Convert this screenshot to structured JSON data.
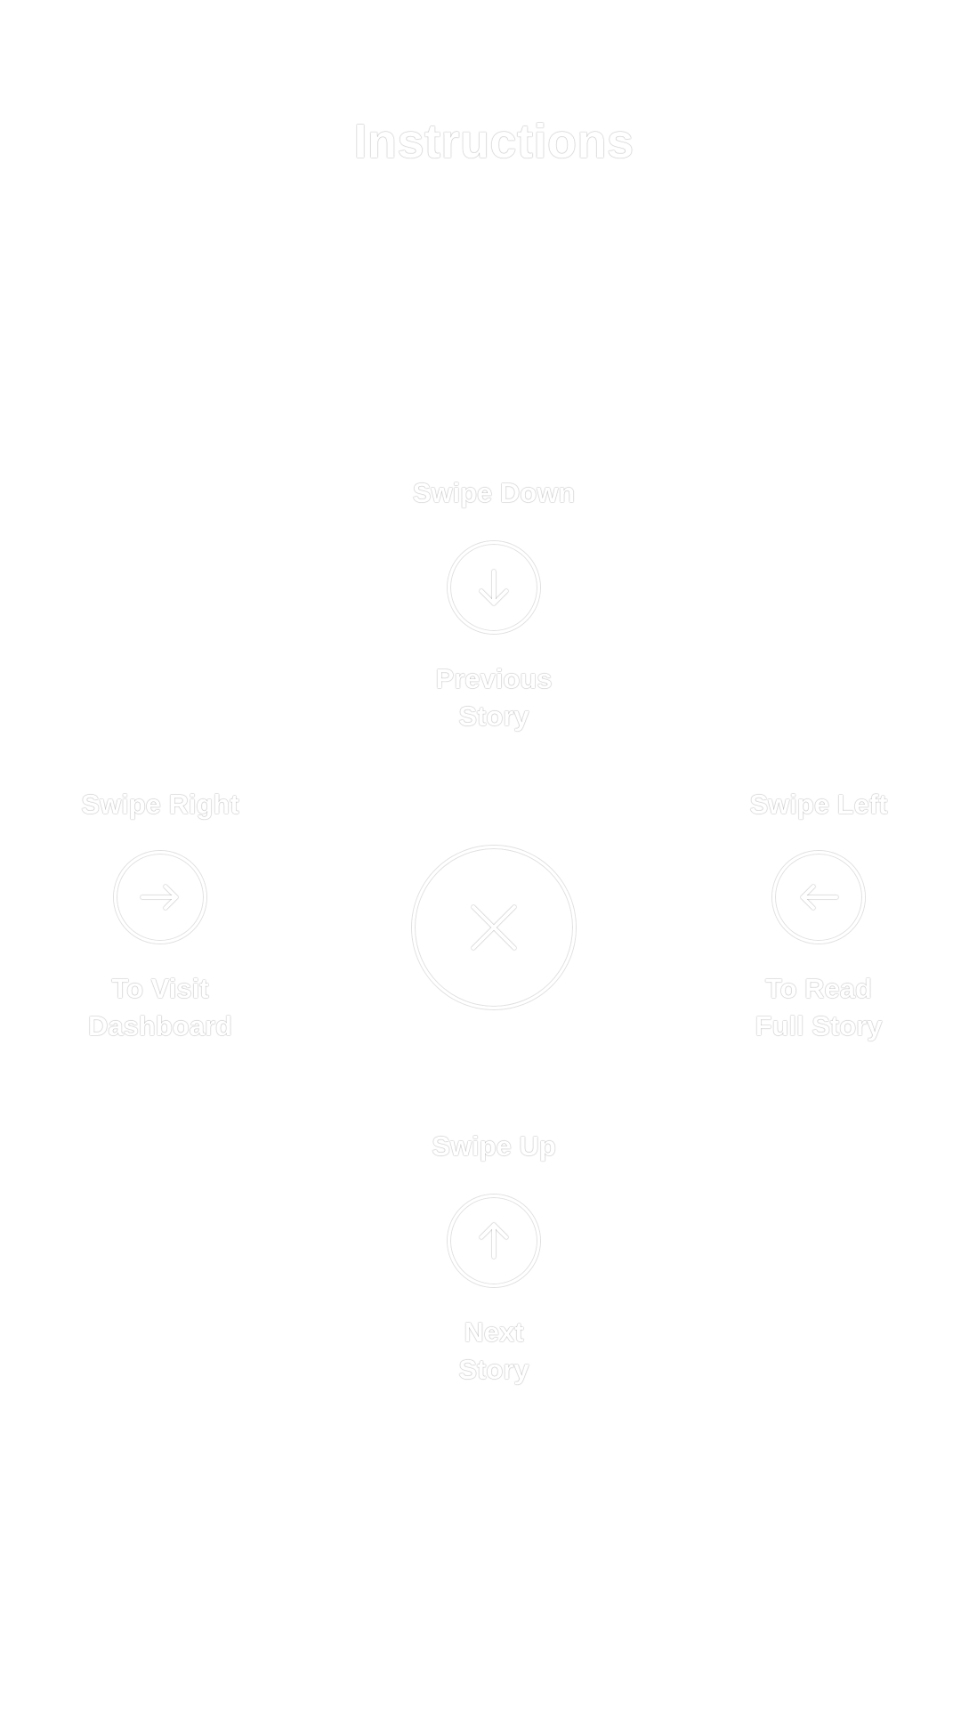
{
  "title": "Instructions",
  "gestures": {
    "down": {
      "heading": "Swipe Down",
      "caption_line1": "Previous",
      "caption_line2": "Story",
      "icon": "arrow-down-icon"
    },
    "right": {
      "heading": "Swipe Right",
      "caption_line1": "To Visit",
      "caption_line2": "Dashboard",
      "icon": "arrow-right-icon"
    },
    "left": {
      "heading": "Swipe Left",
      "caption_line1": "To Read",
      "caption_line2": "Full Story",
      "icon": "arrow-left-icon"
    },
    "up": {
      "heading": "Swipe Up",
      "caption_line1": "Next",
      "caption_line2": "Story",
      "icon": "arrow-up-icon"
    }
  },
  "close_icon": "close-icon",
  "colors": {
    "background": "#ffffff",
    "foreground": "#ffffff"
  }
}
